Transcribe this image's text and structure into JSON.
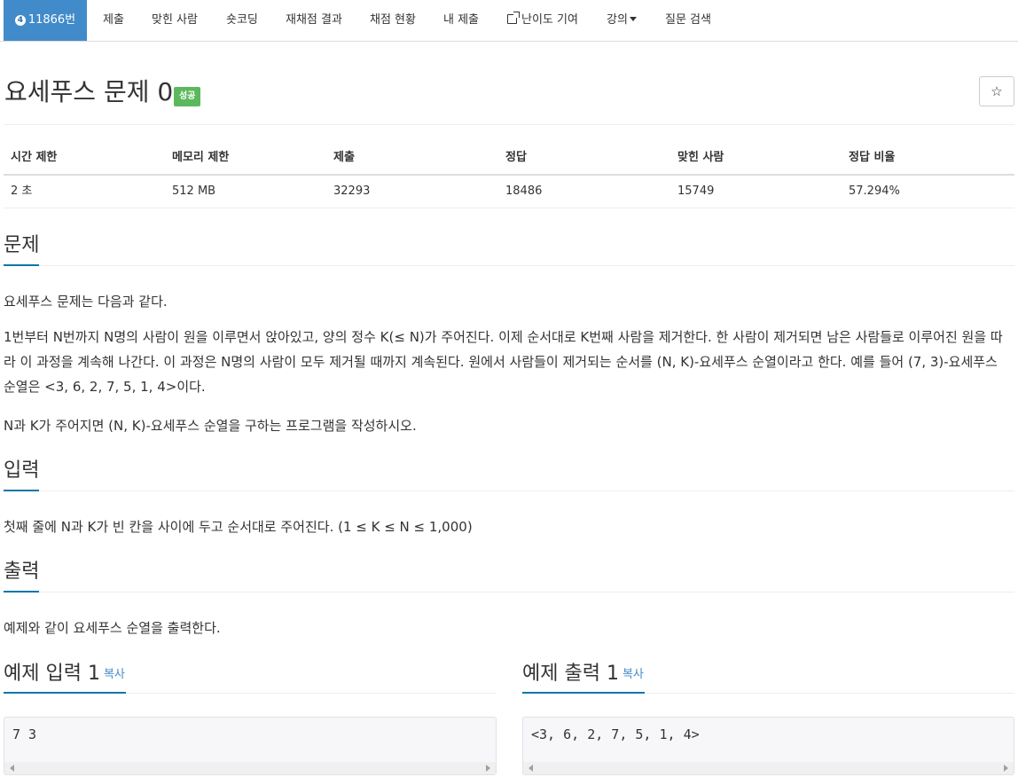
{
  "nav": {
    "problem_number": "11866번",
    "tier_badge": "4",
    "items": [
      "제출",
      "맞힌 사람",
      "숏코딩",
      "재채점 결과",
      "채점 현황",
      "내 제출",
      "난이도 기여",
      "강의",
      "질문 검색"
    ]
  },
  "problem": {
    "title": "요세푸스 문제 0",
    "status_badge": "성공",
    "star_glyph": "☆"
  },
  "info_table": {
    "headers": [
      "시간 제한",
      "메모리 제한",
      "제출",
      "정답",
      "맞힌 사람",
      "정답 비율"
    ],
    "values": [
      "2 초",
      "512 MB",
      "32293",
      "18486",
      "15749",
      "57.294%"
    ]
  },
  "sections": {
    "description": {
      "title": "문제",
      "paragraphs": [
        "요세푸스 문제는 다음과 같다.",
        "1번부터 N번까지 N명의 사람이 원을 이루면서 앉아있고, 양의 정수 K(≤ N)가 주어진다. 이제 순서대로 K번째 사람을 제거한다. 한 사람이 제거되면 남은 사람들로 이루어진 원을 따라 이 과정을 계속해 나간다. 이 과정은 N명의 사람이 모두 제거될 때까지 계속된다. 원에서 사람들이 제거되는 순서를 (N, K)-요세푸스 순열이라고 한다. 예를 들어 (7, 3)-요세푸스 순열은 <3, 6, 2, 7, 5, 1, 4>이다.",
        "N과 K가 주어지면 (N, K)-요세푸스 순열을 구하는 프로그램을 작성하시오."
      ]
    },
    "input": {
      "title": "입력",
      "text": "첫째 줄에 N과 K가 빈 칸을 사이에 두고 순서대로 주어진다. (1 ≤ K ≤ N ≤ 1,000)"
    },
    "output": {
      "title": "출력",
      "text": "예제와 같이 요세푸스 순열을 출력한다."
    }
  },
  "samples": {
    "input_title": "예제 입력 1",
    "output_title": "예제 출력 1",
    "copy_label": "복사",
    "input_value": "7 3",
    "output_value": "<3, 6, 2, 7, 5, 1, 4>"
  }
}
